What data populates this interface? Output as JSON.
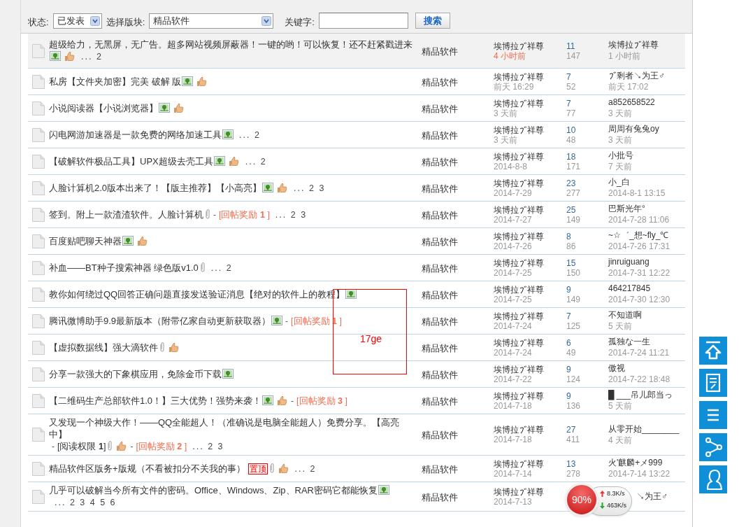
{
  "filter_bar": {
    "status_label": "状态:",
    "status_value": "已发表",
    "forum_label": "选择版块:",
    "forum_value": "精品软件",
    "keyword_label": "关键字:",
    "search_button": "搜索"
  },
  "threads": [
    {
      "selected": true,
      "parts": [
        {
          "kind": "text",
          "text": "超级给力，无黑屏，无广告。超多网站视频屏蔽器！一键的哟！可以恢复！还不赶紧戳进来"
        },
        {
          "kind": "image"
        },
        {
          "kind": "thumb"
        },
        {
          "kind": "pages",
          "text": "... 2"
        }
      ],
      "forum": "精品软件",
      "author": "埃博拉ゞ祥尊",
      "date": "4 小时前",
      "date_new": true,
      "replies": "11",
      "views": "147",
      "last_poster": "埃博拉ゞ祥尊",
      "last_time": "1 小时前"
    },
    {
      "selected": false,
      "parts": [
        {
          "kind": "text",
          "text": "私房【文件夹加密】完美 破解 版"
        },
        {
          "kind": "image"
        },
        {
          "kind": "thumb"
        }
      ],
      "forum": "精品软件",
      "author": "埃博拉ゞ祥尊",
      "date": "前天 16:29",
      "date_new": false,
      "replies": "7",
      "views": "52",
      "last_poster": "ゞ剩者↘为王♂",
      "last_time": "前天 17:02"
    },
    {
      "selected": false,
      "parts": [
        {
          "kind": "text",
          "text": "小说阅读器【小说浏览器】"
        },
        {
          "kind": "image"
        },
        {
          "kind": "thumb"
        }
      ],
      "forum": "精品软件",
      "author": "埃博拉ゞ祥尊",
      "date": "3 天前",
      "date_new": false,
      "replies": "7",
      "views": "77",
      "last_poster": "a852658522",
      "last_time": "3 天前"
    },
    {
      "selected": false,
      "parts": [
        {
          "kind": "text",
          "text": "闪电网游加速器是一款免费的网络加速工具"
        },
        {
          "kind": "image"
        },
        {
          "kind": "pages",
          "text": "... 2"
        }
      ],
      "forum": "精品软件",
      "author": "埃博拉ゞ祥尊",
      "date": "3 天前",
      "date_new": false,
      "replies": "10",
      "views": "48",
      "last_poster": "周周有兔兔oy",
      "last_time": "3 天前"
    },
    {
      "selected": false,
      "parts": [
        {
          "kind": "text",
          "text": "【破解软件极品工具】UPX超级去壳工具"
        },
        {
          "kind": "image"
        },
        {
          "kind": "thumb"
        },
        {
          "kind": "pages",
          "text": "... 2"
        }
      ],
      "forum": "精品软件",
      "author": "埃博拉ゞ祥尊",
      "date": "2014-8-8",
      "date_new": false,
      "replies": "18",
      "views": "171",
      "last_poster": "小批号",
      "last_time": "7 天前"
    },
    {
      "selected": false,
      "parts": [
        {
          "kind": "text",
          "text": "人脸计算机2.0版本出来了！【版主推荐】【小高亮】"
        },
        {
          "kind": "image"
        },
        {
          "kind": "thumb"
        },
        {
          "kind": "pages",
          "text": "... 2 3"
        }
      ],
      "forum": "精品软件",
      "author": "埃博拉ゞ祥尊",
      "date": "2014-7-29",
      "date_new": false,
      "replies": "23",
      "views": "277",
      "last_poster": "小_白",
      "last_time": "2014-8-1 13:15"
    },
    {
      "selected": false,
      "parts": [
        {
          "kind": "text",
          "text": "签到。附上一款渣渣软件。人脸计算机"
        },
        {
          "kind": "attach"
        },
        {
          "kind": "sep",
          "text": "-"
        },
        {
          "kind": "reward",
          "text": "[回帖奖励 **1** ]"
        },
        {
          "kind": "pages",
          "text": "... 2 3"
        }
      ],
      "forum": "精品软件",
      "author": "埃博拉ゞ祥尊",
      "date": "2014-7-27",
      "date_new": false,
      "replies": "25",
      "views": "149",
      "last_poster": "巴斯光年°",
      "last_time": "2014-7-28 11:06"
    },
    {
      "selected": false,
      "parts": [
        {
          "kind": "text",
          "text": "百度贴吧聊天神器"
        },
        {
          "kind": "image"
        },
        {
          "kind": "thumb"
        }
      ],
      "forum": "精品软件",
      "author": "埃博拉ゞ祥尊",
      "date": "2014-7-26",
      "date_new": false,
      "replies": "8",
      "views": "86",
      "last_poster": "~☆゛_想~fly_℃",
      "last_time": "2014-7-26 17:31"
    },
    {
      "selected": false,
      "parts": [
        {
          "kind": "text",
          "text": "补血——BT种子搜索神器 绿色版v1.0"
        },
        {
          "kind": "attach"
        },
        {
          "kind": "pages",
          "text": "... 2"
        }
      ],
      "forum": "精品软件",
      "author": "埃博拉ゞ祥尊",
      "date": "2014-7-25",
      "date_new": false,
      "replies": "15",
      "views": "150",
      "last_poster": "jinruiguang",
      "last_time": "2014-7-31 12:22"
    },
    {
      "selected": false,
      "parts": [
        {
          "kind": "text",
          "text": "教你如何绕过QQ回答正确问题直接发送验证消息【绝对的软件上的教程】"
        },
        {
          "kind": "image"
        }
      ],
      "forum": "精品软件",
      "author": "埃博拉ゞ祥尊",
      "date": "2014-7-25",
      "date_new": false,
      "replies": "9",
      "views": "149",
      "last_poster": "464217845",
      "last_time": "2014-7-30 12:30"
    },
    {
      "selected": false,
      "parts": [
        {
          "kind": "text",
          "text": "腾讯微博助手9.9最新版本（附带亿家自动更新获取器）"
        },
        {
          "kind": "image"
        },
        {
          "kind": "sep",
          "text": "-"
        },
        {
          "kind": "reward",
          "text": "[回帖奖励 **1** ]"
        }
      ],
      "forum": "精品软件",
      "author": "埃博拉ゞ祥尊",
      "date": "2014-7-24",
      "date_new": false,
      "replies": "7",
      "views": "125",
      "last_poster": "不知道啊",
      "last_time": "5 天前"
    },
    {
      "selected": false,
      "parts": [
        {
          "kind": "text",
          "text": "【虚拟数据线】强大滴软件"
        },
        {
          "kind": "attach"
        },
        {
          "kind": "thumb"
        }
      ],
      "forum": "精品软件",
      "author": "埃博拉ゞ祥尊",
      "date": "2014-7-24",
      "date_new": false,
      "replies": "6",
      "views": "49",
      "last_poster": "孤独な一生",
      "last_time": "2014-7-24 11:21"
    },
    {
      "selected": false,
      "parts": [
        {
          "kind": "text",
          "text": "分享一款强大的下象棋应用，免除金币下载"
        },
        {
          "kind": "image"
        }
      ],
      "forum": "精品软件",
      "author": "埃博拉ゞ祥尊",
      "date": "2014-7-22",
      "date_new": false,
      "replies": "9",
      "views": "124",
      "last_poster": "傲视",
      "last_time": "2014-7-22 18:48"
    },
    {
      "selected": false,
      "parts": [
        {
          "kind": "text",
          "text": "【二维码生产总部软件1.0！】三大优势！强势来袭！"
        },
        {
          "kind": "image"
        },
        {
          "kind": "thumb"
        },
        {
          "kind": "sep",
          "text": "-"
        },
        {
          "kind": "reward",
          "text": "[回帖奖励 **3** ]"
        }
      ],
      "forum": "精品软件",
      "author": "埃博拉ゞ祥尊",
      "date": "2014-7-18",
      "date_new": false,
      "replies": "9",
      "views": "136",
      "last_poster": "█ ___吊儿郎当っ",
      "last_time": "5 天前"
    },
    {
      "selected": false,
      "parts": [
        {
          "kind": "text",
          "text": "又发现一个神级大作！——QQ全能超人！（准确说是电脑全能超人）免费分享。【高亮中】"
        },
        {
          "kind": "sep",
          "text": "-"
        },
        {
          "kind": "perm",
          "text": "[阅读权限 **1**]"
        },
        {
          "kind": "attach"
        },
        {
          "kind": "thumb"
        },
        {
          "kind": "sep",
          "text": "-"
        },
        {
          "kind": "reward",
          "text": "[回帖奖励 **2** ]"
        },
        {
          "kind": "pages",
          "text": "... 2 3"
        }
      ],
      "forum": "精品软件",
      "author": "埃博拉ゞ祥尊",
      "date": "2014-7-18",
      "date_new": false,
      "replies": "27",
      "views": "411",
      "last_poster": "从零开始________",
      "last_time": "4 天前"
    },
    {
      "selected": false,
      "parts": [
        {
          "kind": "text",
          "text": "精品软件区版务+版规（不看被扣分不关我的事）"
        },
        {
          "kind": "sticky",
          "text": "置顶"
        },
        {
          "kind": "attach"
        },
        {
          "kind": "thumb"
        },
        {
          "kind": "pages",
          "text": "... 2"
        }
      ],
      "forum": "精品软件",
      "author": "埃博拉ゞ祥尊",
      "date": "2014-7-14",
      "date_new": false,
      "replies": "13",
      "views": "278",
      "last_poster": "火'麒麟+メ999",
      "last_time": "2014-7-14 13:22"
    },
    {
      "selected": false,
      "parts": [
        {
          "kind": "text",
          "text": "几乎可以破解当今所有文件的密码。Office、Windows、Zip、RAR密码它都能恢复"
        },
        {
          "kind": "image"
        },
        {
          "kind": "pages",
          "text": "... 2 3 4 5 6"
        }
      ],
      "forum": "精品软件",
      "author": "埃博拉ゞ祥尊",
      "date": "2014-7-13",
      "date_new": false,
      "last_poster": "↘为王♂"
    }
  ],
  "side_buttons": [
    {
      "kind": "top"
    },
    {
      "kind": "post"
    },
    {
      "kind": "list"
    },
    {
      "kind": "share"
    },
    {
      "kind": "user"
    }
  ],
  "annotation": {
    "text": "17ge"
  },
  "speed_widget": {
    "percent": "90%",
    "upload": "8.3K/s",
    "download": "463K/s"
  }
}
